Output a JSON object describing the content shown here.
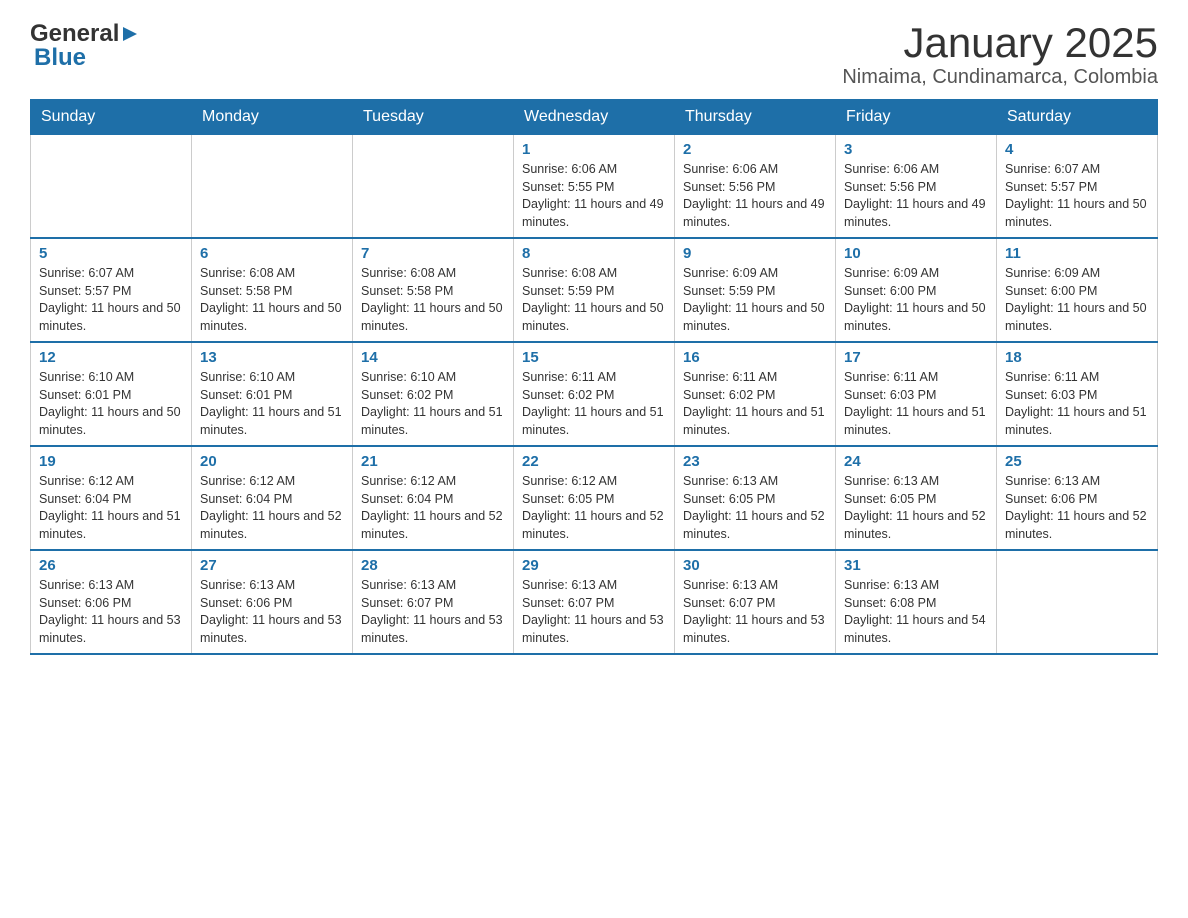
{
  "header": {
    "logo_general": "General",
    "logo_blue": "Blue",
    "title": "January 2025",
    "subtitle": "Nimaima, Cundinamarca, Colombia"
  },
  "calendar": {
    "days_of_week": [
      "Sunday",
      "Monday",
      "Tuesday",
      "Wednesday",
      "Thursday",
      "Friday",
      "Saturday"
    ],
    "weeks": [
      [
        {
          "day": "",
          "info": ""
        },
        {
          "day": "",
          "info": ""
        },
        {
          "day": "",
          "info": ""
        },
        {
          "day": "1",
          "info": "Sunrise: 6:06 AM\nSunset: 5:55 PM\nDaylight: 11 hours and 49 minutes."
        },
        {
          "day": "2",
          "info": "Sunrise: 6:06 AM\nSunset: 5:56 PM\nDaylight: 11 hours and 49 minutes."
        },
        {
          "day": "3",
          "info": "Sunrise: 6:06 AM\nSunset: 5:56 PM\nDaylight: 11 hours and 49 minutes."
        },
        {
          "day": "4",
          "info": "Sunrise: 6:07 AM\nSunset: 5:57 PM\nDaylight: 11 hours and 50 minutes."
        }
      ],
      [
        {
          "day": "5",
          "info": "Sunrise: 6:07 AM\nSunset: 5:57 PM\nDaylight: 11 hours and 50 minutes."
        },
        {
          "day": "6",
          "info": "Sunrise: 6:08 AM\nSunset: 5:58 PM\nDaylight: 11 hours and 50 minutes."
        },
        {
          "day": "7",
          "info": "Sunrise: 6:08 AM\nSunset: 5:58 PM\nDaylight: 11 hours and 50 minutes."
        },
        {
          "day": "8",
          "info": "Sunrise: 6:08 AM\nSunset: 5:59 PM\nDaylight: 11 hours and 50 minutes."
        },
        {
          "day": "9",
          "info": "Sunrise: 6:09 AM\nSunset: 5:59 PM\nDaylight: 11 hours and 50 minutes."
        },
        {
          "day": "10",
          "info": "Sunrise: 6:09 AM\nSunset: 6:00 PM\nDaylight: 11 hours and 50 minutes."
        },
        {
          "day": "11",
          "info": "Sunrise: 6:09 AM\nSunset: 6:00 PM\nDaylight: 11 hours and 50 minutes."
        }
      ],
      [
        {
          "day": "12",
          "info": "Sunrise: 6:10 AM\nSunset: 6:01 PM\nDaylight: 11 hours and 50 minutes."
        },
        {
          "day": "13",
          "info": "Sunrise: 6:10 AM\nSunset: 6:01 PM\nDaylight: 11 hours and 51 minutes."
        },
        {
          "day": "14",
          "info": "Sunrise: 6:10 AM\nSunset: 6:02 PM\nDaylight: 11 hours and 51 minutes."
        },
        {
          "day": "15",
          "info": "Sunrise: 6:11 AM\nSunset: 6:02 PM\nDaylight: 11 hours and 51 minutes."
        },
        {
          "day": "16",
          "info": "Sunrise: 6:11 AM\nSunset: 6:02 PM\nDaylight: 11 hours and 51 minutes."
        },
        {
          "day": "17",
          "info": "Sunrise: 6:11 AM\nSunset: 6:03 PM\nDaylight: 11 hours and 51 minutes."
        },
        {
          "day": "18",
          "info": "Sunrise: 6:11 AM\nSunset: 6:03 PM\nDaylight: 11 hours and 51 minutes."
        }
      ],
      [
        {
          "day": "19",
          "info": "Sunrise: 6:12 AM\nSunset: 6:04 PM\nDaylight: 11 hours and 51 minutes."
        },
        {
          "day": "20",
          "info": "Sunrise: 6:12 AM\nSunset: 6:04 PM\nDaylight: 11 hours and 52 minutes."
        },
        {
          "day": "21",
          "info": "Sunrise: 6:12 AM\nSunset: 6:04 PM\nDaylight: 11 hours and 52 minutes."
        },
        {
          "day": "22",
          "info": "Sunrise: 6:12 AM\nSunset: 6:05 PM\nDaylight: 11 hours and 52 minutes."
        },
        {
          "day": "23",
          "info": "Sunrise: 6:13 AM\nSunset: 6:05 PM\nDaylight: 11 hours and 52 minutes."
        },
        {
          "day": "24",
          "info": "Sunrise: 6:13 AM\nSunset: 6:05 PM\nDaylight: 11 hours and 52 minutes."
        },
        {
          "day": "25",
          "info": "Sunrise: 6:13 AM\nSunset: 6:06 PM\nDaylight: 11 hours and 52 minutes."
        }
      ],
      [
        {
          "day": "26",
          "info": "Sunrise: 6:13 AM\nSunset: 6:06 PM\nDaylight: 11 hours and 53 minutes."
        },
        {
          "day": "27",
          "info": "Sunrise: 6:13 AM\nSunset: 6:06 PM\nDaylight: 11 hours and 53 minutes."
        },
        {
          "day": "28",
          "info": "Sunrise: 6:13 AM\nSunset: 6:07 PM\nDaylight: 11 hours and 53 minutes."
        },
        {
          "day": "29",
          "info": "Sunrise: 6:13 AM\nSunset: 6:07 PM\nDaylight: 11 hours and 53 minutes."
        },
        {
          "day": "30",
          "info": "Sunrise: 6:13 AM\nSunset: 6:07 PM\nDaylight: 11 hours and 53 minutes."
        },
        {
          "day": "31",
          "info": "Sunrise: 6:13 AM\nSunset: 6:08 PM\nDaylight: 11 hours and 54 minutes."
        },
        {
          "day": "",
          "info": ""
        }
      ]
    ]
  }
}
